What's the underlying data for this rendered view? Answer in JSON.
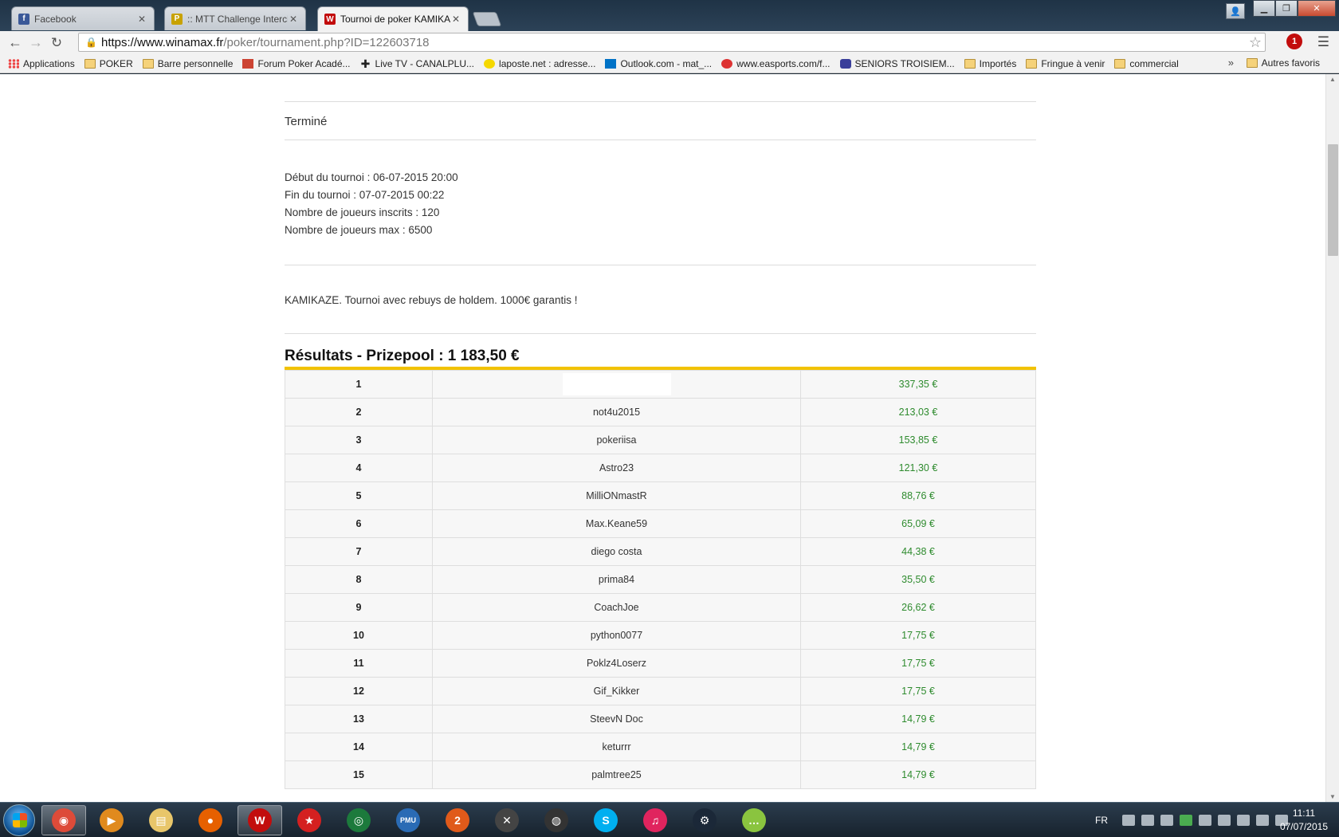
{
  "browser": {
    "tabs": [
      {
        "title": "Facebook",
        "icon": "facebook-icon",
        "color": "#3b5998",
        "glyph": "f"
      },
      {
        "title": ":: MTT Challenge Interclub",
        "icon": "forum-icon",
        "color": "#c8a200",
        "glyph": "P"
      },
      {
        "title": "Tournoi de poker KAMIKAZE",
        "icon": "winamax-icon",
        "color": "#c20d0d",
        "glyph": "W"
      }
    ],
    "url_host": "https://www.winamax.fr",
    "url_rest": "/poker/tournament.php?ID=122603718",
    "extension_badge": "1"
  },
  "bookmarks": {
    "items": [
      {
        "label": "Applications",
        "icon": "apps-grid-icon"
      },
      {
        "label": "POKER",
        "icon": "folder-icon"
      },
      {
        "label": "Barre personnelle",
        "icon": "folder-icon"
      },
      {
        "label": "Forum Poker Acadé...",
        "icon": "forum-icon"
      },
      {
        "label": "Live TV - CANALPLU...",
        "icon": "plus-icon"
      },
      {
        "label": "laposte.net : adresse...",
        "icon": "laposte-icon"
      },
      {
        "label": "Outlook.com - mat_...",
        "icon": "outlook-icon"
      },
      {
        "label": "www.easports.com/f...",
        "icon": "ea-icon"
      },
      {
        "label": "SENIORS TROISIEM...",
        "icon": "club-icon"
      },
      {
        "label": "Importés",
        "icon": "folder-icon"
      },
      {
        "label": "Fringue à venir",
        "icon": "folder-icon"
      },
      {
        "label": "commercial",
        "icon": "folder-icon"
      }
    ],
    "more": "»",
    "other": "Autres favoris"
  },
  "page": {
    "status": "Terminé",
    "info": [
      "Début du tournoi : 06-07-2015 20:00",
      "Fin du tournoi : 07-07-2015 00:22",
      "Nombre de joueurs inscrits : 120",
      "Nombre de joueurs max : 6500"
    ],
    "description": "KAMIKAZE. Tournoi avec rebuys de holdem. 1000€ garantis !",
    "results_title": "Résultats - Prizepool : 1 183,50 €",
    "accent_color": "#f2c200",
    "gain_color": "#2e8b2e",
    "results": [
      {
        "rank": "1",
        "player": "",
        "gain": "337,35 €"
      },
      {
        "rank": "2",
        "player": "not4u2015",
        "gain": "213,03 €"
      },
      {
        "rank": "3",
        "player": "pokeriisa",
        "gain": "153,85 €"
      },
      {
        "rank": "4",
        "player": "Astro23",
        "gain": "121,30 €"
      },
      {
        "rank": "5",
        "player": "MilliONmastR",
        "gain": "88,76 €"
      },
      {
        "rank": "6",
        "player": "Max.Keane59",
        "gain": "65,09 €"
      },
      {
        "rank": "7",
        "player": "diego costa",
        "gain": "44,38 €"
      },
      {
        "rank": "8",
        "player": "prima84",
        "gain": "35,50 €"
      },
      {
        "rank": "9",
        "player": "CoachJoe",
        "gain": "26,62 €"
      },
      {
        "rank": "10",
        "player": "python0077",
        "gain": "17,75 €"
      },
      {
        "rank": "11",
        "player": "Poklz4Loserz",
        "gain": "17,75 €"
      },
      {
        "rank": "12",
        "player": "Gif_Kikker",
        "gain": "17,75 €"
      },
      {
        "rank": "13",
        "player": "SteevN Doc",
        "gain": "14,79 €"
      },
      {
        "rank": "14",
        "player": "keturrr",
        "gain": "14,79 €"
      },
      {
        "rank": "15",
        "player": "palmtree25",
        "gain": "14,79 €"
      }
    ]
  },
  "taskbar": {
    "apps": [
      {
        "name": "chrome-icon",
        "color": "#dd4b39",
        "glyph": "◉",
        "active": true
      },
      {
        "name": "media-player-icon",
        "color": "#e08a1e",
        "glyph": "▶"
      },
      {
        "name": "explorer-icon",
        "color": "#e8c66a",
        "glyph": "▤"
      },
      {
        "name": "firefox-icon",
        "color": "#e66000",
        "glyph": "●"
      },
      {
        "name": "winamax-icon",
        "color": "#c20d0d",
        "glyph": "W",
        "active": true
      },
      {
        "name": "pokerstars-icon",
        "color": "#d42020",
        "glyph": "★"
      },
      {
        "name": "poker-client-icon",
        "color": "#1c7a3c",
        "glyph": "◎"
      },
      {
        "name": "pmu-icon",
        "color": "#2a6bb5",
        "glyph": "PMU"
      },
      {
        "name": "pt-2-icon",
        "color": "#e05a1a",
        "glyph": "2"
      },
      {
        "name": "tool-icon",
        "color": "#444444",
        "glyph": "✕"
      },
      {
        "name": "tournament-icon",
        "color": "#333333",
        "glyph": "◍"
      },
      {
        "name": "skype-icon",
        "color": "#00aff0",
        "glyph": "S"
      },
      {
        "name": "itunes-icon",
        "color": "#e0245e",
        "glyph": "♫"
      },
      {
        "name": "steam-icon",
        "color": "#1b2838",
        "glyph": "⚙"
      },
      {
        "name": "chat-icon",
        "color": "#8ac43f",
        "glyph": "…"
      }
    ],
    "language": "FR",
    "time": "11:11",
    "date": "07/07/2015"
  }
}
